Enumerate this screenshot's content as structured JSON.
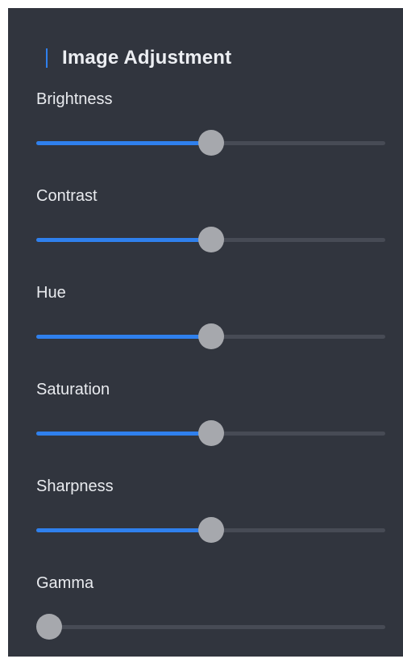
{
  "panel": {
    "title": "Image Adjustment",
    "accent_color": "#2f80ed"
  },
  "sliders": [
    {
      "label": "Brightness",
      "value": 0.5
    },
    {
      "label": "Contrast",
      "value": 0.5
    },
    {
      "label": "Hue",
      "value": 0.5
    },
    {
      "label": "Saturation",
      "value": 0.5
    },
    {
      "label": "Sharpness",
      "value": 0.5
    },
    {
      "label": "Gamma",
      "value": 0.0
    }
  ]
}
